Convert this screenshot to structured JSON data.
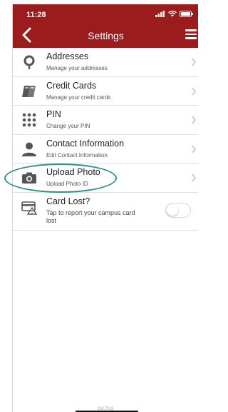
{
  "status": {
    "time": "11:28"
  },
  "nav": {
    "title": "Settings"
  },
  "items": [
    {
      "label": "Addresses",
      "sub": "Manage your addresses",
      "icon": "map-pin-icon"
    },
    {
      "label": "Credit Cards",
      "sub": "Manage your credit cards",
      "icon": "credit-cards-icon"
    },
    {
      "label": "PIN",
      "sub": "Change your PIN",
      "icon": "keypad-icon"
    },
    {
      "label": "Contact Information",
      "sub": "Edit Contact Information",
      "icon": "person-icon"
    },
    {
      "label": "Upload Photo",
      "sub": "Upload Photo ID",
      "icon": "camera-icon"
    },
    {
      "label": "Card Lost?",
      "sub": "Tap to report your campus card lost",
      "icon": "card-warning-icon"
    }
  ],
  "toggle": {
    "on": false
  },
  "footer": {
    "text": "2.6.70.3"
  },
  "colors": {
    "brand": "#9b1c1c",
    "highlight": "#2f8f8a"
  }
}
